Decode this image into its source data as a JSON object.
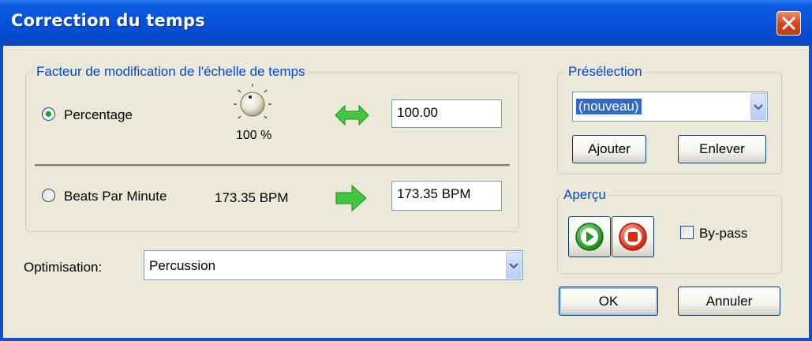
{
  "window": {
    "title": "Correction du temps"
  },
  "scale_group": {
    "legend": "Facteur de modification de l'échelle de temps",
    "percentage": {
      "label": "Percentage",
      "selected": true,
      "knob_value": "100 %",
      "input_value": "100.00"
    },
    "bpm": {
      "label": "Beats Par Minute",
      "selected": false,
      "current_value": "173.35 BPM",
      "input_value": "173.35 BPM"
    }
  },
  "optimisation": {
    "label": "Optimisation:",
    "value": "Percussion"
  },
  "preset_group": {
    "legend": "Présélection",
    "selected": "(nouveau)",
    "add_label": "Ajouter",
    "remove_label": "Enlever"
  },
  "preview_group": {
    "legend": "Aperçu",
    "bypass_label": "By-pass",
    "bypass_checked": false
  },
  "buttons": {
    "ok": "OK",
    "cancel": "Annuler"
  },
  "colors": {
    "titlebar": "#0651d8",
    "legend_text": "#0046d5",
    "arrow_green": "#3fc23f",
    "play_green": "#1f9b1f",
    "stop_red": "#e02a10"
  },
  "icons": {
    "close": "close-icon",
    "knob": "knob-icon",
    "double_arrow": "double-arrow-icon",
    "right_arrow": "right-arrow-icon",
    "play": "play-icon",
    "stop": "stop-icon"
  }
}
